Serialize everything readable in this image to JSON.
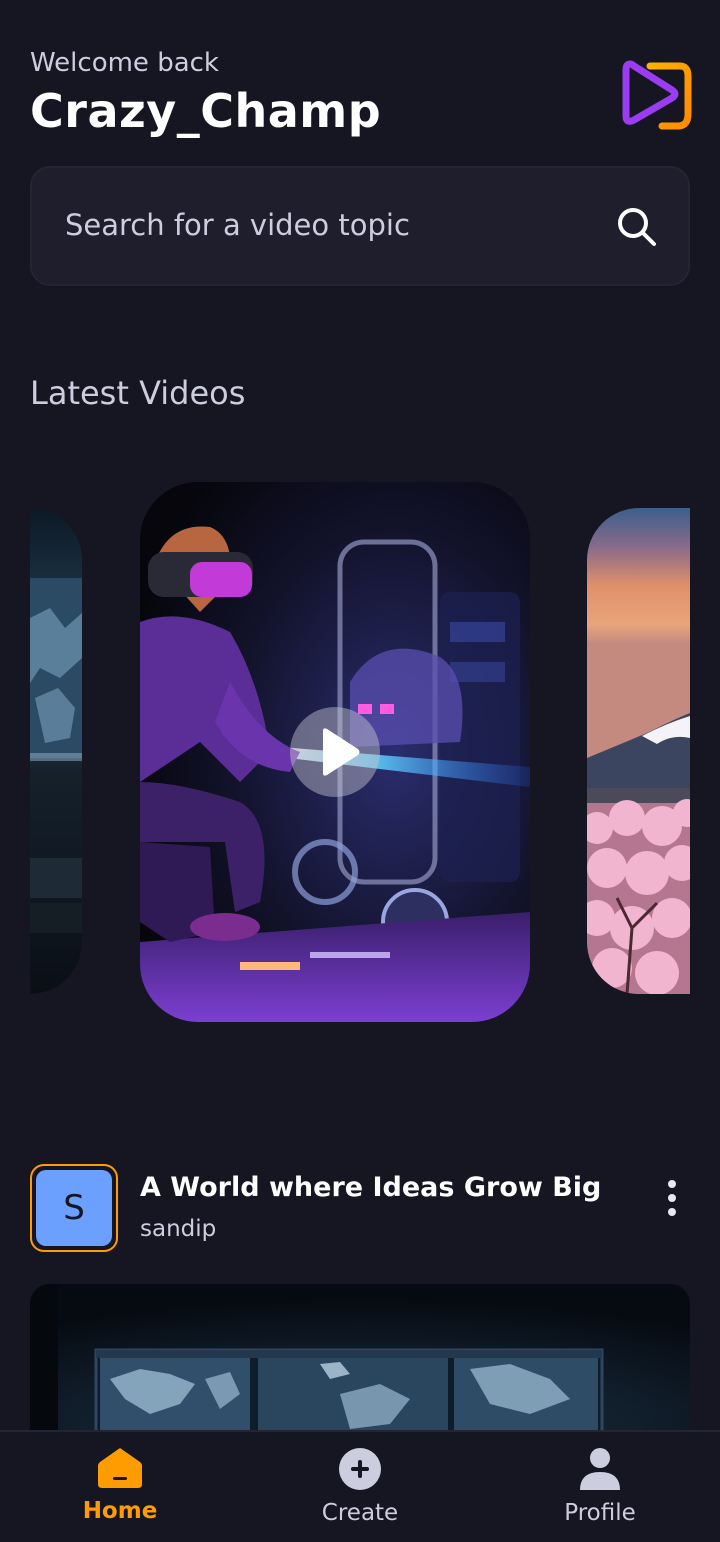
{
  "header": {
    "greeting": "Welcome back",
    "username": "Crazy_Champ",
    "logo_icon": "app-logo-icon"
  },
  "search": {
    "placeholder": "Search for a video topic",
    "icon": "search-icon"
  },
  "latest": {
    "title": "Latest Videos",
    "items": [
      {
        "icon": "world-map-thumbnail"
      },
      {
        "icon": "vr-robot-thumbnail",
        "play_icon": "play-icon"
      },
      {
        "icon": "mount-fuji-thumbnail"
      }
    ]
  },
  "post": {
    "avatar_letter": "S",
    "title": "A World where Ideas Grow Big",
    "author": "sandip",
    "menu_icon": "more-vertical-icon"
  },
  "tabs": [
    {
      "label": "Home",
      "icon": "home-icon",
      "active": true
    },
    {
      "label": "Create",
      "icon": "plus-circle-icon",
      "active": false
    },
    {
      "label": "Profile",
      "icon": "profile-icon",
      "active": false
    }
  ],
  "colors": {
    "background": "#161622",
    "accent": "#ff9c01",
    "card": "#1e1e2d",
    "muted_text": "#cdcde0"
  }
}
